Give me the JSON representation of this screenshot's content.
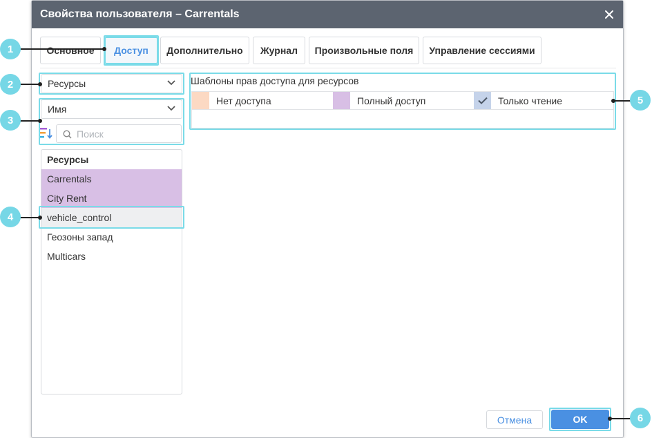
{
  "dialog": {
    "title": "Свойства пользователя – Carrentals",
    "close_icon": "close-icon"
  },
  "tabs": [
    {
      "label": "Основное",
      "active": false
    },
    {
      "label": "Доступ",
      "active": true
    },
    {
      "label": "Дополнительно",
      "active": false
    },
    {
      "label": "Журнал",
      "active": false
    },
    {
      "label": "Произвольные поля",
      "active": false
    },
    {
      "label": "Управление сессиями",
      "active": false
    }
  ],
  "left_panel": {
    "type_select": "Ресурсы",
    "sort_select": "Имя",
    "sort_icon": "sort-icon",
    "search_placeholder": "Поиск",
    "list_header": "Ресурсы",
    "items": [
      {
        "label": "Carrentals",
        "highlight": "purple"
      },
      {
        "label": "City Rent",
        "highlight": "purple"
      },
      {
        "label": "vehicle_control",
        "highlight": "selected"
      },
      {
        "label": "Геозоны запад",
        "highlight": "none"
      },
      {
        "label": "Multicars",
        "highlight": "none"
      }
    ]
  },
  "templates": {
    "title": "Шаблоны прав доступа для ресурсов",
    "legend": [
      {
        "label": "Нет доступа",
        "color": "#fcd9c3"
      },
      {
        "label": "Полный доступ",
        "color": "#d8bfe5"
      },
      {
        "label": "Только чтение",
        "color": "#c5d3ea",
        "icon": "check-icon"
      }
    ]
  },
  "footer": {
    "cancel_label": "Отмена",
    "ok_label": "OK"
  },
  "callouts": [
    "1",
    "2",
    "3",
    "4",
    "5",
    "6"
  ],
  "colors": {
    "titlebar": "#5c6470",
    "accent": "#4a90e2",
    "callout": "#76d7e6",
    "highlight_outline": "#7adbe8",
    "purple_row": "#d8bfe5",
    "selected_row": "#eeeff1"
  }
}
